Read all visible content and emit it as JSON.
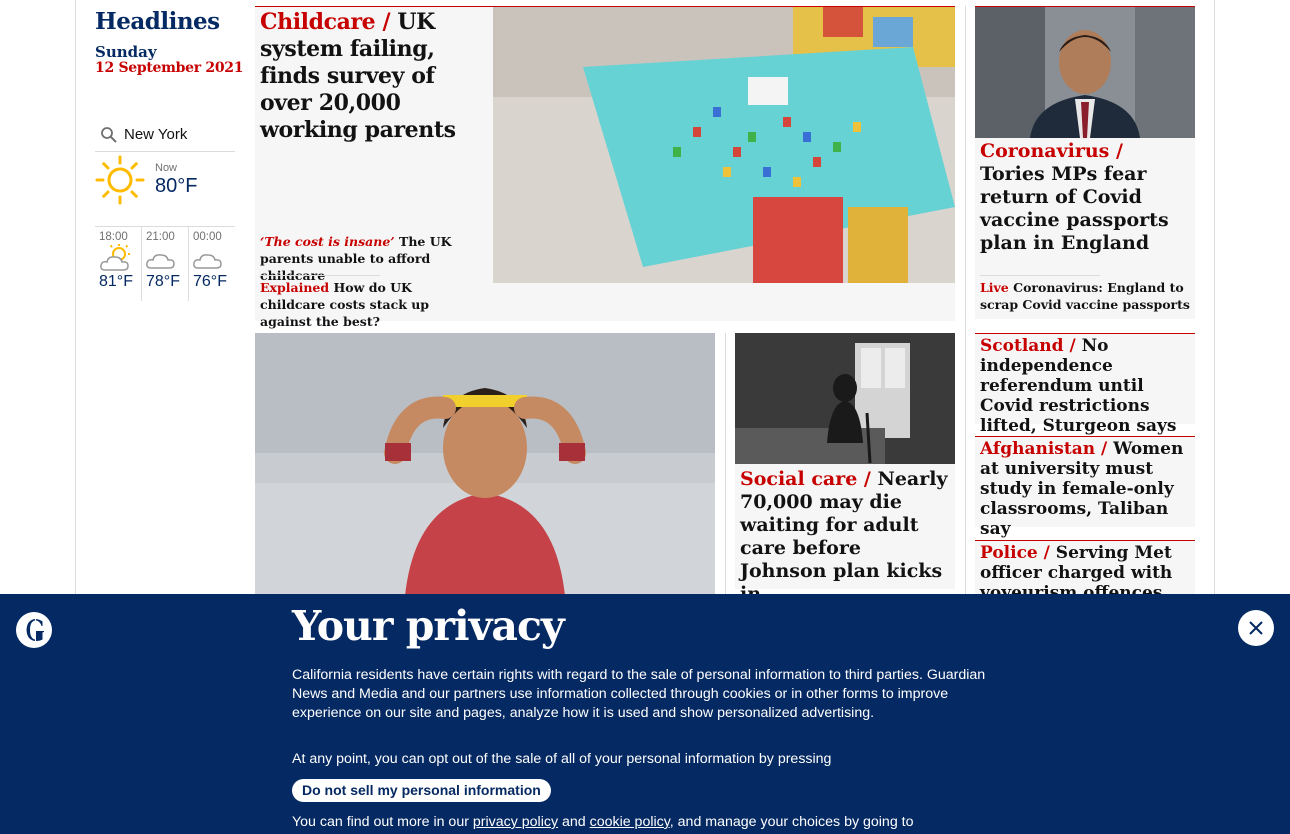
{
  "sidebar": {
    "title": "Headlines",
    "day": "Sunday",
    "date": "12 September 2021"
  },
  "weather": {
    "location_value": "New York",
    "now_label": "Now",
    "now_temp": "80°F",
    "now_icon": "sun-icon",
    "forecast": [
      {
        "time": "18:00",
        "temp": "81°F",
        "icon": "sun-cloud-icon"
      },
      {
        "time": "21:00",
        "temp": "78°F",
        "icon": "moon-cloud-icon"
      },
      {
        "time": "00:00",
        "temp": "76°F",
        "icon": "moon-cloud-icon"
      }
    ]
  },
  "lead": {
    "kicker": "Childcare /",
    "headline": " UK system failing, finds survey of over 20,000 working parents",
    "sublinks": [
      {
        "kicker": "‘The cost is insane’",
        "text": " The UK parents unable to afford childcare"
      },
      {
        "kicker": "Explained",
        "text": " How do UK childcare costs stack up against the best?"
      }
    ]
  },
  "social_care": {
    "kicker": "Social care /",
    "headline": " Nearly 70,000 may die waiting for adult care before Johnson plan kicks in"
  },
  "right_column": [
    {
      "kicker": "Coronavirus /",
      "headline": " Tories MPs fear return of Covid vaccine passports plan in England",
      "live_kicker": "Live",
      "live_text": " Coronavirus: England to scrap Covid vaccine passports"
    },
    {
      "kicker": "Scotland  /",
      "headline": " No independence referendum until Covid restrictions lifted, Sturgeon says"
    },
    {
      "kicker": "Afghanistan /",
      "headline": " Women at university must study in female-only classrooms, Taliban say"
    },
    {
      "kicker": "Police /",
      "headline": " Serving Met officer charged with voyeurism offences"
    }
  ],
  "privacy": {
    "title": "Your privacy",
    "body": "California residents have certain rights with regard to the sale of personal information to third parties. Guardian News and Media and our partners use information collected through cookies or in other forms to improve experience on our site and pages, analyze how it is used and show personalized advertising.",
    "optout": "At any point, you can opt out of the sale of all of your personal information by pressing",
    "button": "Do not sell my personal information",
    "findout_prefix": "You can find out more in our ",
    "privacy_link": "privacy policy",
    "and": " and ",
    "cookie_link": "cookie policy",
    "findout_suffix": ", and manage your choices by going to"
  },
  "colors": {
    "brand_blue": "#052962",
    "news_red": "#c70000",
    "panel_grey": "#f6f6f6"
  }
}
